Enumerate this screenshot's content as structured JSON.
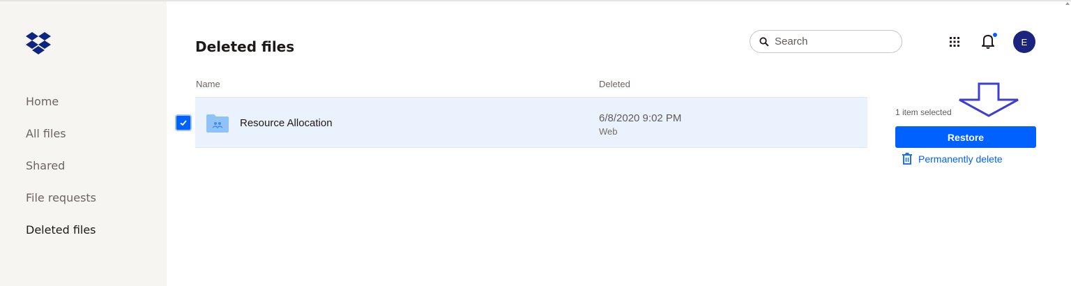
{
  "sidebar": {
    "logo": "dropbox-logo",
    "items": [
      {
        "label": "Home"
      },
      {
        "label": "All files"
      },
      {
        "label": "Shared"
      },
      {
        "label": "File requests"
      },
      {
        "label": "Deleted files"
      }
    ],
    "active": "Deleted files"
  },
  "header": {
    "title": "Deleted files",
    "search_placeholder": "Search",
    "avatar_initial": "E",
    "icons": [
      "apps-grid-icon",
      "bell-icon"
    ]
  },
  "table": {
    "columns": [
      "Name",
      "Deleted"
    ],
    "rows": [
      {
        "name": "Resource Allocation",
        "deleted": "6/8/2020 9:02 PM",
        "source": "Web",
        "selected": true,
        "icon": "shared-folder-icon"
      }
    ]
  },
  "selection_panel": {
    "count_text": "1 item selected",
    "restore_label": "Restore",
    "permanently_delete_label": "Permanently delete"
  },
  "colors": {
    "accent": "#0061fe",
    "sidebar_bg": "#f7f5f2",
    "selected_row_bg": "#eaf2fd",
    "avatar_bg": "#1a237e",
    "annotation_arrow": "#3f3fcf"
  }
}
